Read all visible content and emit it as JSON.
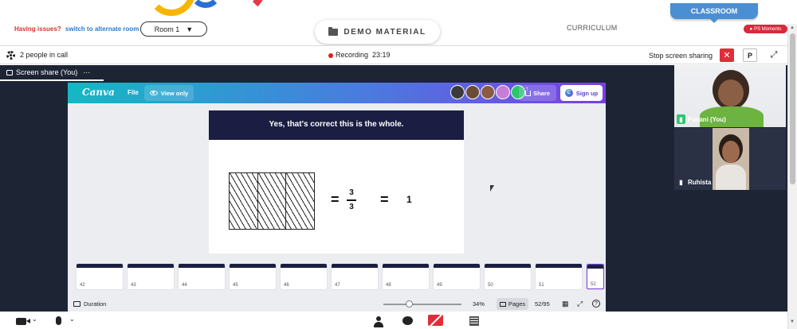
{
  "header": {
    "issue_prefix": "Having issues?",
    "issue_link": "switch to alternate room",
    "room_value": "Room 1",
    "demo_material": "DEMO MATERIAL",
    "curriculum": "CURRICULUM",
    "classroom_tab": "CLASSROOM",
    "ps_moments": "PS Moments"
  },
  "call_bar": {
    "people_count": "2 people in call",
    "recording_label": "Recording",
    "recording_time": "23:19",
    "stop_sharing": "Stop screen sharing",
    "p_label": "P"
  },
  "share_tab": {
    "label": "Screen share (You)",
    "more": "···"
  },
  "canva": {
    "logo": "Canva",
    "file": "File",
    "view_only": "View only",
    "share": "Share",
    "signup": "Sign up",
    "avatar_colors": [
      "#3b3b3b",
      "#6a4b3a",
      "#8c5b44",
      "#c77dd8",
      "#2ec470"
    ]
  },
  "slide": {
    "title": "Yes, that's correct this is the whole.",
    "numerator": "3",
    "denominator": "3",
    "equals": "=",
    "result": "1"
  },
  "thumbnails": [
    {
      "num": "42"
    },
    {
      "num": "43"
    },
    {
      "num": "44"
    },
    {
      "num": "45"
    },
    {
      "num": "46"
    },
    {
      "num": "47"
    },
    {
      "num": "48"
    },
    {
      "num": "49"
    },
    {
      "num": "50"
    },
    {
      "num": "51"
    },
    {
      "num": "52"
    }
  ],
  "footer": {
    "duration": "Duration",
    "zoom": "34%",
    "pages": "Pages",
    "page_count": "52/95",
    "help": "?"
  },
  "participants": [
    {
      "name": "Pavani (You)"
    },
    {
      "name": "Ruhista"
    }
  ]
}
